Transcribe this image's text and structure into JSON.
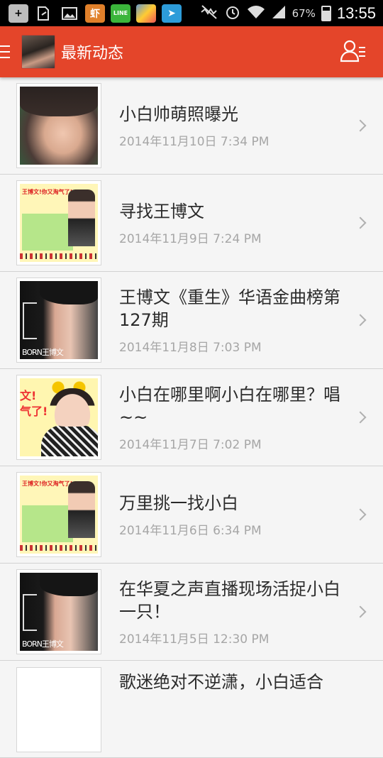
{
  "status_bar": {
    "icons": [
      "add-icon",
      "share-icon",
      "image-icon",
      "app-xia-icon",
      "line-icon",
      "game-icon",
      "telegram-icon",
      "mute-icon",
      "alarm-icon",
      "wifi-icon",
      "signal-icon"
    ],
    "xia_label": "虾",
    "line_label": "LINE",
    "battery": "67%",
    "time": "13:55"
  },
  "app_bar": {
    "title": "最新动态",
    "accent_color": "#e4452a"
  },
  "feed": [
    {
      "title": "小白帅萌照曝光",
      "date": "2014年11月10日 7:34 PM",
      "thumb": "portrait"
    },
    {
      "title": "寻找王博文",
      "date": "2014年11月9日 7:24 PM",
      "thumb": "poster",
      "poster_text": "王博文!你又淘气了!"
    },
    {
      "title": "王博文《重生》华语金曲榜第127期",
      "date": "2014年11月8日 7:03 PM",
      "thumb": "reborn",
      "thumb_text": "BORN王博文"
    },
    {
      "title": "小白在哪里啊小白在哪里？唱~~",
      "date": "2014年11月7日 7:02 PM",
      "thumb": "bear",
      "thumb_text": "文!\n气了!"
    },
    {
      "title": "万里挑一找小白",
      "date": "2014年11月6日 6:34 PM",
      "thumb": "poster",
      "poster_text": "王博文!你又淘气了!"
    },
    {
      "title": "在华夏之声直播现场活捉小白一只！",
      "date": "2014年11月5日 12:30 PM",
      "thumb": "reborn",
      "thumb_text": "BORN王博文"
    },
    {
      "title": "歌迷绝对不逆潇，小白适合",
      "date": "",
      "thumb": "blank"
    }
  ]
}
